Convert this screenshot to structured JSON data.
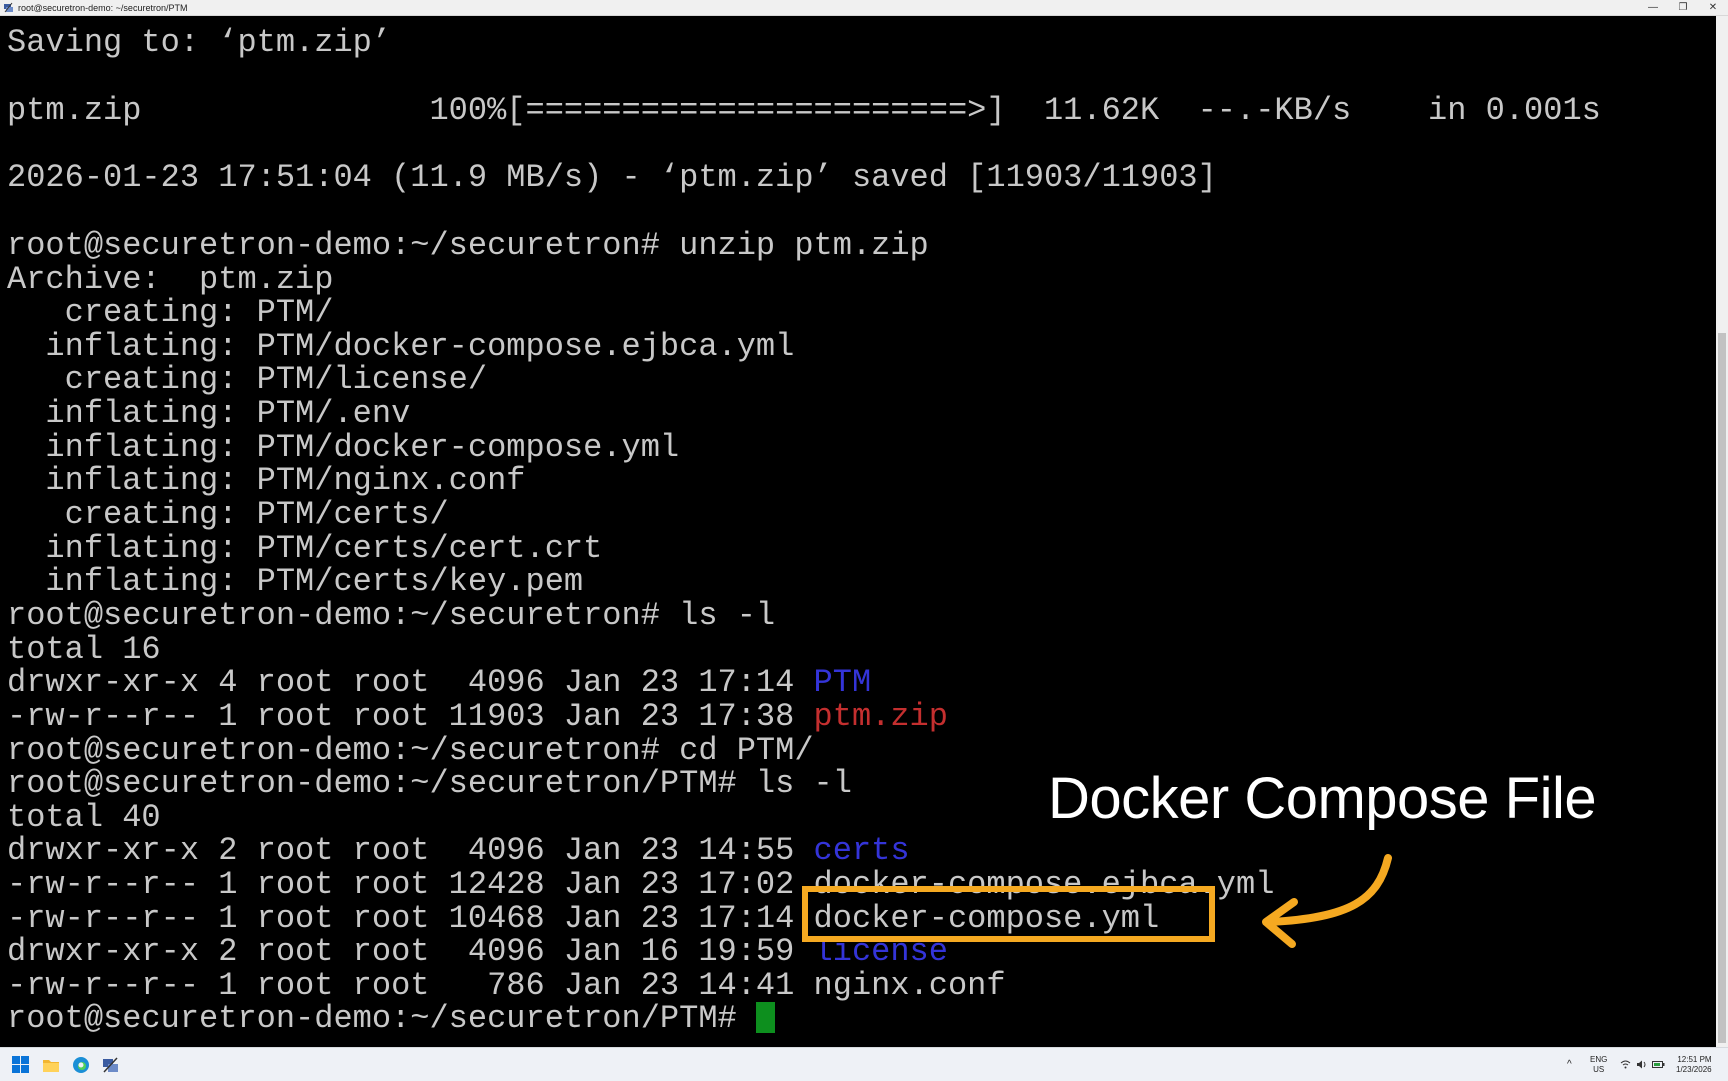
{
  "window": {
    "title": "root@securetron-demo: ~/securetron/PTM",
    "controls": {
      "minimize": "—",
      "restore": "❐",
      "close": "✕"
    }
  },
  "terminal": {
    "lines": [
      "Saving to: ‘ptm.zip’",
      "",
      "ptm.zip               100%[=======================>]  11.62K  --.-KB/s    in 0.001s",
      "",
      "2026-01-23 17:51:04 (11.9 MB/s) - ‘ptm.zip’ saved [11903/11903]",
      "",
      "root@securetron-demo:~/securetron# unzip ptm.zip",
      "Archive:  ptm.zip",
      "   creating: PTM/",
      "  inflating: PTM/docker-compose.ejbca.yml",
      "   creating: PTM/license/",
      "  inflating: PTM/.env",
      "  inflating: PTM/docker-compose.yml",
      "  inflating: PTM/nginx.conf",
      "   creating: PTM/certs/",
      "  inflating: PTM/certs/cert.crt",
      "  inflating: PTM/certs/key.pem",
      "root@securetron-demo:~/securetron# ls -l",
      "total 16"
    ],
    "listing1": [
      {
        "meta": "drwxr-xr-x 4 root root  4096 Jan 23 17:14 ",
        "name": "PTM",
        "kind": "dir"
      },
      {
        "meta": "-rw-r--r-- 1 root root 11903 Jan 23 17:38 ",
        "name": "ptm.zip",
        "kind": "zip"
      }
    ],
    "cmd_cd": "root@securetron-demo:~/securetron# cd PTM/",
    "cmd_ls": "root@securetron-demo:~/securetron/PTM# ls -l",
    "total2": "total 40",
    "listing2": [
      {
        "meta": "drwxr-xr-x 2 root root  4096 Jan 23 14:55 ",
        "name": "certs",
        "kind": "dir"
      },
      {
        "meta": "-rw-r--r-- 1 root root 12428 Jan 23 17:02 ",
        "name": "docker-compose.ejbca.yml",
        "kind": "file"
      },
      {
        "meta": "-rw-r--r-- 1 root root 10468 Jan 23 17:14 ",
        "name": "docker-compose.yml",
        "kind": "file"
      },
      {
        "meta": "drwxr-xr-x 2 root root  4096 Jan 16 19:59 ",
        "name": "license",
        "kind": "dir"
      },
      {
        "meta": "-rw-r--r-- 1 root root   786 Jan 23 14:41 ",
        "name": "nginx.conf",
        "kind": "file"
      }
    ],
    "prompt": "root@securetron-demo:~/securetron/PTM# ",
    "colors": {
      "text": "#c8c8c8",
      "dir": "#3434d8",
      "zip": "#c42f2f",
      "cursor": "#0d8f1e"
    }
  },
  "annotation": {
    "label": "Docker Compose File",
    "color": "#f5a921"
  },
  "taskbar": {
    "icons": [
      "windows-start-icon",
      "file-explorer-icon",
      "edge-browser-icon",
      "putty-icon"
    ],
    "tray": {
      "lang": "ENG",
      "region": "US",
      "time": "12:51 PM",
      "date": "1/23/2026"
    }
  }
}
